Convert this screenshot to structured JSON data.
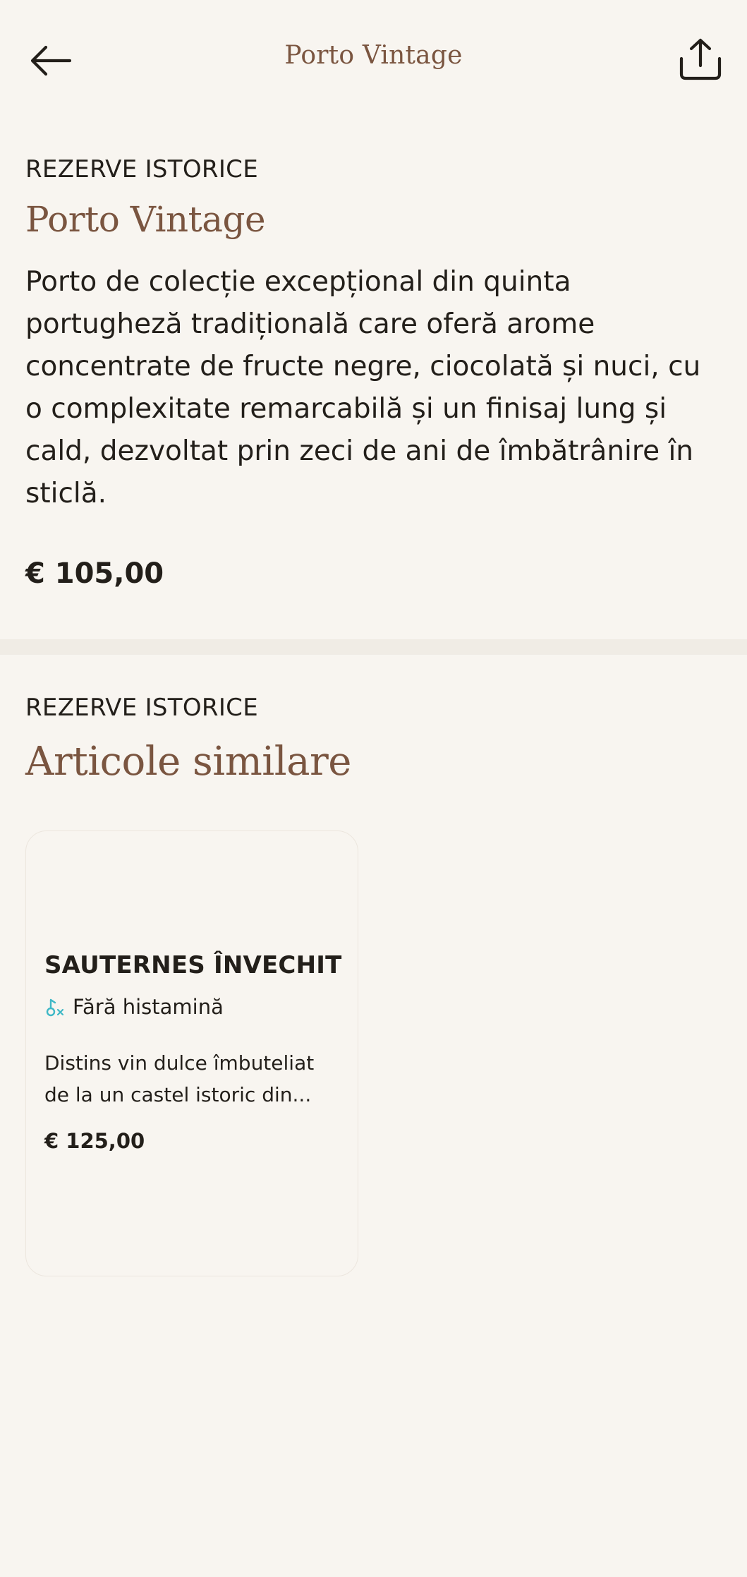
{
  "header": {
    "title": "Porto Vintage",
    "back_icon": "arrow-left-icon",
    "share_icon": "share-icon"
  },
  "product": {
    "category": "REZERVE ISTORICE",
    "name": "Porto Vintage",
    "description": "Porto de colecție excepțional din quinta portugheză tradițională care oferă arome concentrate de fructe negre, ciocolată și nuci, cu o complexitate remarcabilă și un finisaj lung și cald, dezvoltat prin zeci de ani de îmbătrânire în sticlă.",
    "price": "€ 105,00"
  },
  "similar": {
    "category": "REZERVE ISTORICE",
    "title": "Articole similare",
    "items": [
      {
        "name": "SAUTERNES ÎNVECHIT",
        "tag": "Fără histamină",
        "tag_icon": "histamine-free-icon",
        "description": "Distins vin dulce îmbuteliat de la un castel istoric din...",
        "price": "€ 125,00"
      }
    ]
  },
  "colors": {
    "background": "#f8f5f0",
    "accent_brown": "#7a5540",
    "text": "#231f1a",
    "tag_icon": "#3fb8c6"
  }
}
